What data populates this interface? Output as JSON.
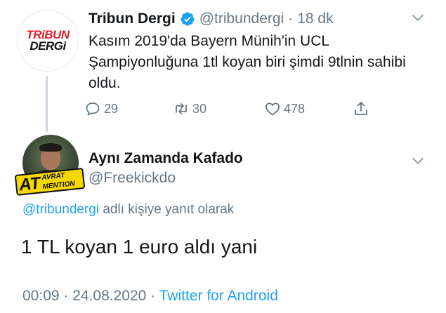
{
  "tweet1": {
    "avatar": {
      "line1": "TRiBUN",
      "line2": "DERGi"
    },
    "name": "Tribun Dergi",
    "handle": "@tribundergi",
    "separator": "·",
    "time": "18 dk",
    "text": "Kasım 2019'da Bayern Münih'in UCL Şampiyonluğuna 1tl koyan biri şimdi 9tlnin sahibi oldu.",
    "actions": {
      "reply_count": "29",
      "retweet_count": "30",
      "like_count": "478"
    }
  },
  "tweet2": {
    "avatar_badge": {
      "big": "AT",
      "small1": "AVRAT",
      "small2": "MENTION"
    },
    "name": "Aynı Zamanda Kafado",
    "handle": "@Freekickdo",
    "reply_to": {
      "mention": "@tribundergi",
      "suffix": " adlı kişiye yanıt olarak"
    },
    "text": "1 TL koyan 1 euro aldı yani",
    "meta": {
      "time": "00:09",
      "separator": " · ",
      "date": "24.08.2020",
      "source": "Twitter for Android"
    }
  },
  "colors": {
    "accent": "#1da1f2",
    "muted": "#657786",
    "text": "#14171a"
  },
  "icons": [
    "verified-icon",
    "chevron-down-icon",
    "reply-icon",
    "retweet-icon",
    "like-icon",
    "share-icon"
  ]
}
